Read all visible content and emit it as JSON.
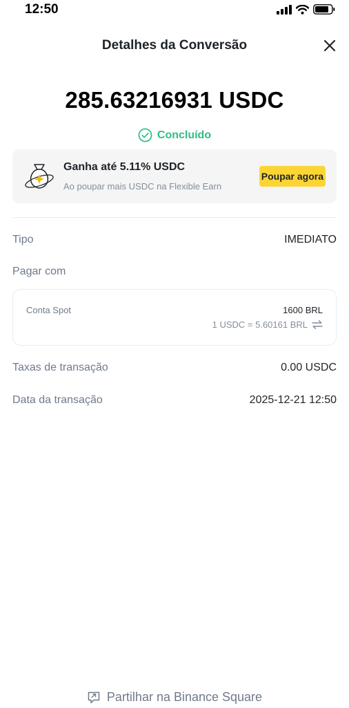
{
  "statusbar": {
    "time": "12:50",
    "icons": [
      "signal-icon",
      "wifi-icon",
      "battery-icon"
    ]
  },
  "header": {
    "title": "Detalhes da Conversão",
    "close_icon": "close-icon"
  },
  "summary": {
    "amount": "285.63216931 USDC",
    "status": "Concluído",
    "status_icon": "check-circle-icon",
    "status_color": "#2EBD85"
  },
  "promo": {
    "icon": "money-bag-icon",
    "title": "Ganha até 5.11% USDC",
    "subtitle": "Ao poupar mais USDC na Flexible Earn",
    "button_label": "Poupar agora",
    "button_color": "#FCD535"
  },
  "details": {
    "tipo_label": "Tipo",
    "tipo_value": "IMEDIATO",
    "pagar_label": "Pagar com",
    "pay_card": {
      "account_label": "Conta Spot",
      "amount": "1600 BRL",
      "rate": "1 USDC = 5.60161 BRL",
      "swap_icon": "swap-icon"
    },
    "fee_label": "Taxas de transação",
    "fee_value": "0.00 USDC",
    "date_label": "Data da transação",
    "date_value": "2025-12-21 12:50"
  },
  "footer": {
    "share_label": "Partilhar na Binance Square",
    "share_icon": "share-icon"
  }
}
